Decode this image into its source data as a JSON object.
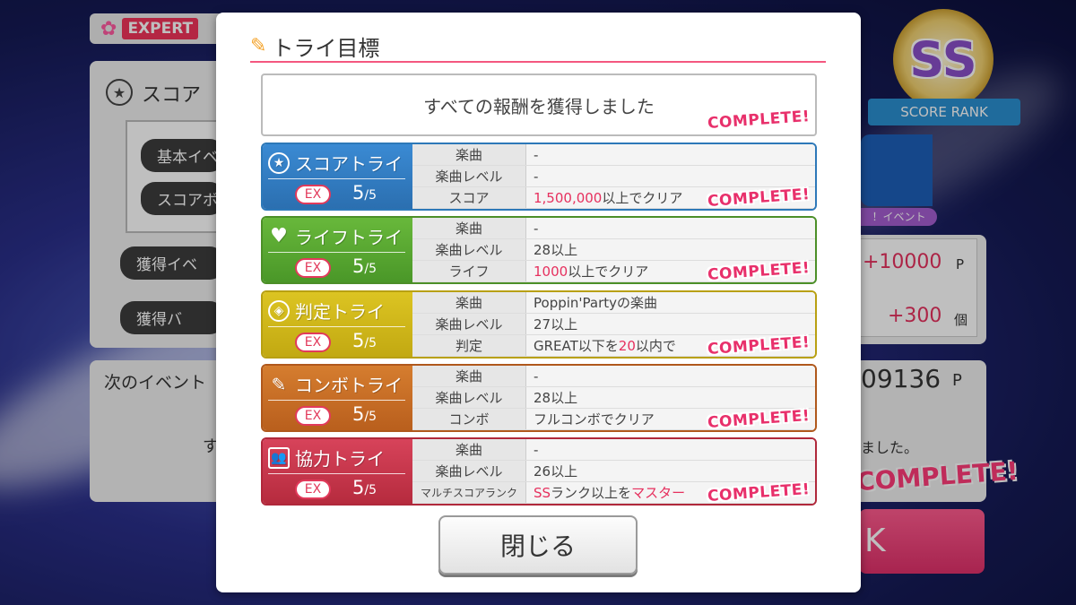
{
  "background": {
    "difficulty": "EXPERT",
    "score_label": "スコア",
    "pills": [
      "基本イベ",
      "スコアボ",
      "獲得イベ",
      "獲得バ"
    ],
    "next_event": "次のイベント",
    "points_1": "+10000",
    "points_1_unit": "P",
    "points_2": "+300",
    "points_2_unit": "個",
    "total_points": "09136",
    "total_unit": "P",
    "ended_text": "ました。",
    "partial_su": "す",
    "rank_letters": "SS",
    "rank_label": "SCORE RANK",
    "event_tag": "！イベント",
    "complete": "COMPLETE!",
    "button_partial": "K"
  },
  "modal": {
    "title": "トライ目標",
    "all_rewards": "すべての報酬を獲得しました",
    "complete_label": "COMPLETE!",
    "close_label": "閉じる",
    "ex_label": "EX",
    "cards": [
      {
        "name": "スコアトライ",
        "count": "5",
        "total": "/5",
        "rows": [
          {
            "k": "楽曲",
            "v": "-"
          },
          {
            "k": "楽曲レベル",
            "v": "-"
          },
          {
            "k": "スコア",
            "v_hl": "1,500,000",
            "v": "以上でクリア"
          }
        ]
      },
      {
        "name": "ライフトライ",
        "count": "5",
        "total": "/5",
        "rows": [
          {
            "k": "楽曲",
            "v": "-"
          },
          {
            "k": "楽曲レベル",
            "v": "28以上"
          },
          {
            "k": "ライフ",
            "v_hl": "1000",
            "v": "以上でクリア"
          }
        ]
      },
      {
        "name": "判定トライ",
        "count": "5",
        "total": "/5",
        "rows": [
          {
            "k": "楽曲",
            "v": "Poppin'Partyの楽曲"
          },
          {
            "k": "楽曲レベル",
            "v": "27以上"
          },
          {
            "k": "判定",
            "v_pre": "GREAT以下を",
            "v_hl": "20",
            "v": "以内で"
          }
        ]
      },
      {
        "name": "コンボトライ",
        "count": "5",
        "total": "/5",
        "rows": [
          {
            "k": "楽曲",
            "v": "-"
          },
          {
            "k": "楽曲レベル",
            "v": "28以上"
          },
          {
            "k": "コンボ",
            "v": "フルコンボでクリア"
          }
        ]
      },
      {
        "name": "協力トライ",
        "count": "5",
        "total": "/5",
        "rows": [
          {
            "k": "楽曲",
            "v": "-"
          },
          {
            "k": "楽曲レベル",
            "v": "26以上"
          },
          {
            "k": "マルチスコアランク",
            "v_hl": "SS",
            "v": "ランク以上を",
            "v_hl2": "マスター"
          }
        ]
      }
    ]
  }
}
